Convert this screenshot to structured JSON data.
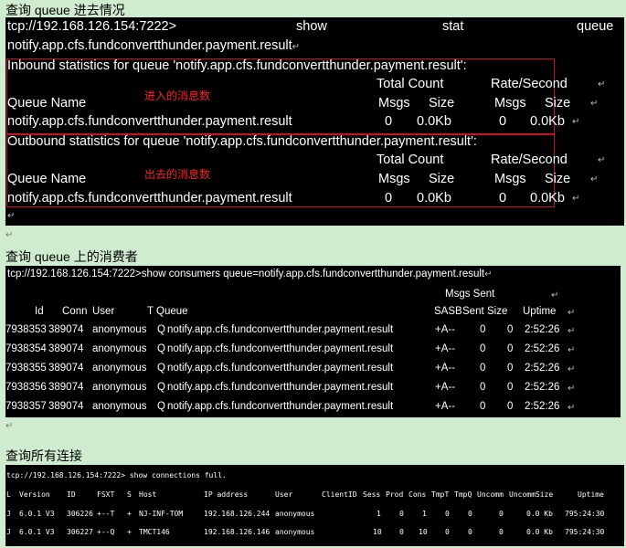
{
  "section1": {
    "heading": "查询 queue 进去情况",
    "cmd_line1": [
      "tcp://192.168.126.154:7222>",
      "show",
      "stat",
      "queue"
    ],
    "cmd_line2": "notify.app.cfs.fundconvertthunder.payment.result",
    "inbound": {
      "title": "Inbound statistics for queue 'notify.app.cfs.fundconvertthunder.payment.result':",
      "annotation": "进入的消息数",
      "total_count": "Total Count",
      "rate": "Rate/Second",
      "queue_name": "Queue Name",
      "msgs": "Msgs",
      "size": "Size",
      "row": {
        "name": "notify.app.cfs.fundconvertthunder.payment.result",
        "total_msgs": "0",
        "total_size": "0.0Kb",
        "rate_msgs": "0",
        "rate_size": "0.0Kb"
      }
    },
    "outbound": {
      "title": "Outbound statistics for queue 'notify.app.cfs.fundconvertthunder.payment.result':",
      "annotation": "出去的消息数",
      "total_count": "Total Count",
      "rate": "Rate/Second",
      "queue_name": "Queue Name",
      "msgs": "Msgs",
      "size": "Size",
      "row": {
        "name": "notify.app.cfs.fundconvertthunder.payment.result",
        "total_msgs": "0",
        "total_size": "0.0Kb",
        "rate_msgs": "0",
        "rate_size": "0.0Kb"
      }
    }
  },
  "section2": {
    "heading": "查询 queue 上的消费者",
    "cmd": "tcp://192.168.126.154:7222>show consumers queue=notify.app.cfs.fundconvertthunder.payment.result",
    "msgs_sent": "Msgs Sent",
    "headers": {
      "id": "Id",
      "conn": "Conn",
      "user": "User",
      "t": "T",
      "queue": "Queue",
      "sasb": "SASB",
      "sent": "Sent",
      "size": "Size",
      "uptime": "Uptime"
    },
    "rows": [
      {
        "id": "7938353",
        "conn": "389074",
        "user": "anonymous",
        "t": "Q",
        "queue": "notify.app.cfs.fundconvertthunder.payment.result",
        "sasb": "+A--",
        "sent": "0",
        "size": "0",
        "uptime": "2:52:26"
      },
      {
        "id": "7938354",
        "conn": "389074",
        "user": "anonymous",
        "t": "Q",
        "queue": "notify.app.cfs.fundconvertthunder.payment.result",
        "sasb": "+A--",
        "sent": "0",
        "size": "0",
        "uptime": "2:52:26"
      },
      {
        "id": "7938355",
        "conn": "389074",
        "user": "anonymous",
        "t": "Q",
        "queue": "notify.app.cfs.fundconvertthunder.payment.result",
        "sasb": "+A--",
        "sent": "0",
        "size": "0",
        "uptime": "2:52:26"
      },
      {
        "id": "7938356",
        "conn": "389074",
        "user": "anonymous",
        "t": "Q",
        "queue": "notify.app.cfs.fundconvertthunder.payment.result",
        "sasb": "+A--",
        "sent": "0",
        "size": "0",
        "uptime": "2:52:26"
      },
      {
        "id": "7938357",
        "conn": "389074",
        "user": "anonymous",
        "t": "Q",
        "queue": "notify.app.cfs.fundconvertthunder.payment.result",
        "sasb": "+A--",
        "sent": "0",
        "size": "0",
        "uptime": "2:52:26"
      }
    ]
  },
  "section3": {
    "heading": "查询所有连接",
    "cmd": "tcp://192.168.126.154:7222> show connections full.",
    "headers": [
      "L",
      "Version",
      "ID",
      "FSXT",
      "S",
      "Host",
      "IP address",
      "User",
      "ClientID",
      "Sess",
      "Prod",
      "Cons",
      "TmpT",
      "TmpQ",
      "Uncomm",
      "UncommSize",
      "Uptime"
    ],
    "rows": [
      [
        "J",
        "6.0.1 V3",
        "306226",
        "+--T",
        "+",
        "NJ-INF-TOM",
        "192.168.126.244",
        "anonymous",
        "",
        "1",
        "0",
        "1",
        "0",
        "0",
        "0",
        "0.0 Kb",
        "795:24:30"
      ],
      [
        "J",
        "6.0.1 V3",
        "306227",
        "+--Q",
        "+",
        "TMCT146",
        "192.168.126.146",
        "anonymous",
        "",
        "10",
        "0",
        "10",
        "0",
        "0",
        "0",
        "0.0 Kb",
        "795:24:30"
      ]
    ]
  },
  "paragraph_mark": "↵"
}
